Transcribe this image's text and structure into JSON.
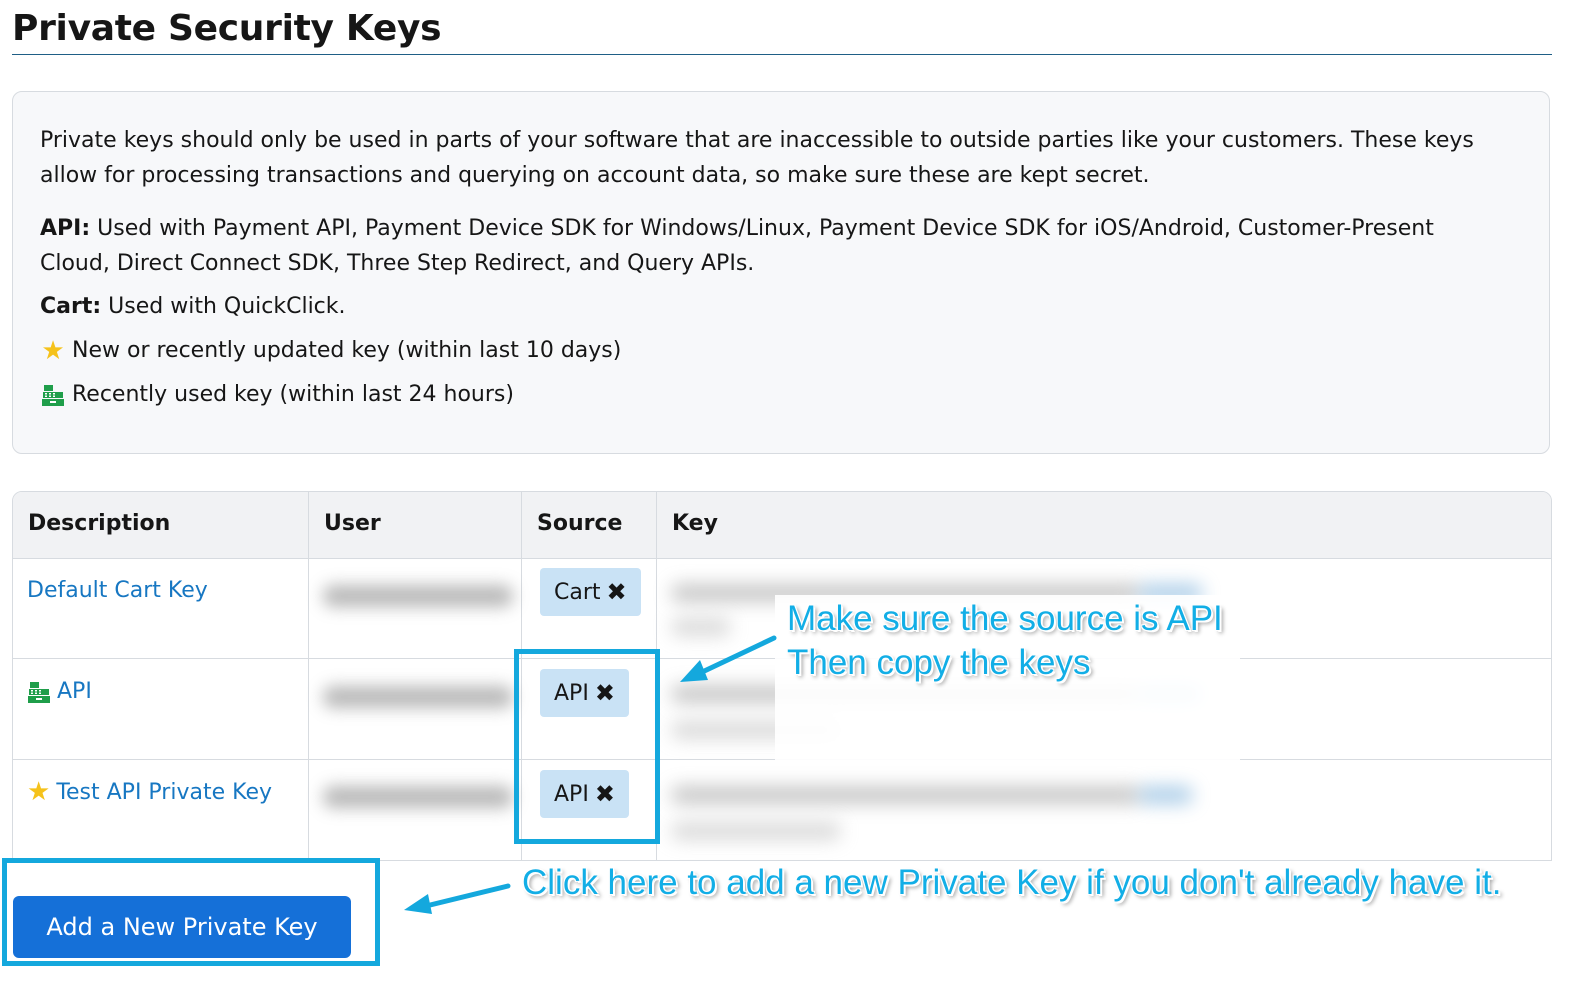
{
  "page": {
    "title": "Private Security Keys"
  },
  "info": {
    "intro": "Private keys should only be used in parts of your software that are inaccessible to outside parties like your customers. These keys allow for processing transactions and querying on account data, so make sure these are kept secret.",
    "api_label": "API:",
    "api_text": "Used with Payment API, Payment Device SDK for Windows/Linux, Payment Device SDK for iOS/Android, Customer-Present Cloud, Direct Connect SDK, Three Step Redirect, and Query APIs.",
    "cart_label": "Cart:",
    "cart_text": "Used with QuickClick.",
    "legend_new": "New or recently updated key (within last 10 days)",
    "legend_used": "Recently used key (within last 24 hours)"
  },
  "table": {
    "headers": {
      "description": "Description",
      "user": "User",
      "source": "Source",
      "key": "Key"
    },
    "rows": [
      {
        "description": "Default Cart Key",
        "source": "Cart",
        "icon": null
      },
      {
        "description": "API",
        "source": "API",
        "icon": "cash-register-icon"
      },
      {
        "description": "Test API Private Key",
        "source": "API",
        "icon": "star-icon"
      }
    ]
  },
  "annotations": {
    "source_note_line1": "Make sure the source is API",
    "source_note_line2": "Then copy the keys",
    "add_note": "Click here to add a new Private Key if you don't already have it."
  },
  "actions": {
    "add_key_label": "Add a New Private Key"
  },
  "colors": {
    "link": "#1777c2",
    "badge": "#c9e2f5",
    "button": "#1570d8",
    "annotation": "#14a8dd",
    "star": "#f5c21b",
    "register": "#1f9e4a"
  }
}
